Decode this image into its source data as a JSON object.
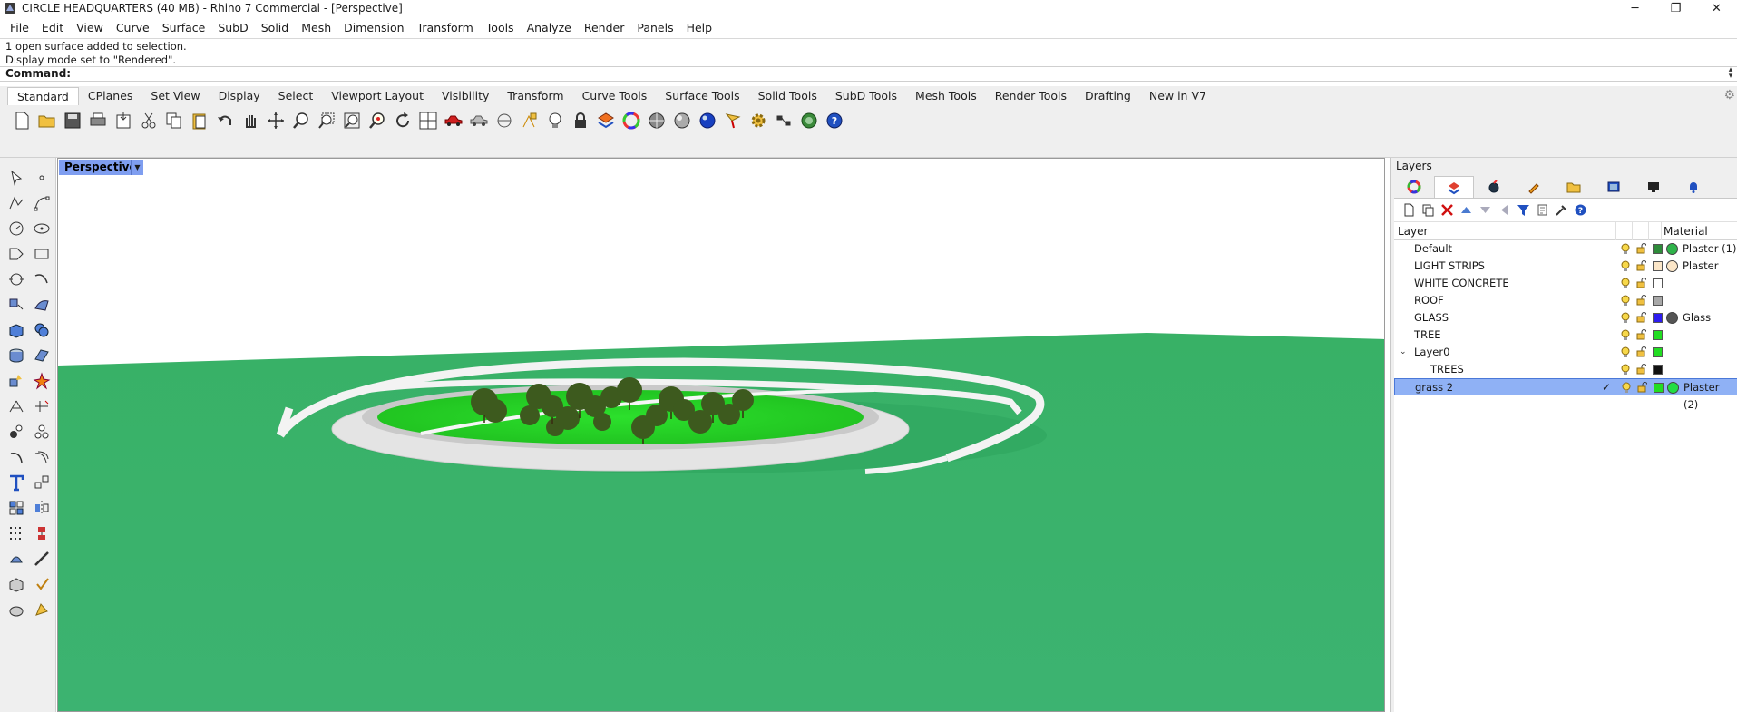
{
  "window": {
    "title": "CIRCLE HEADQUARTERS (40 MB) - Rhino 7 Commercial - [Perspective]",
    "controls": {
      "minimize": "─",
      "maximize": "❐",
      "close": "✕"
    }
  },
  "menu": [
    "File",
    "Edit",
    "View",
    "Curve",
    "Surface",
    "SubD",
    "Solid",
    "Mesh",
    "Dimension",
    "Transform",
    "Tools",
    "Analyze",
    "Render",
    "Panels",
    "Help"
  ],
  "command": {
    "history": [
      "1 open surface added to selection.",
      "Display mode set to \"Rendered\"."
    ],
    "prompt": "Command:"
  },
  "toolbar_tabs": {
    "active": "Standard",
    "items": [
      "Standard",
      "CPlanes",
      "Set View",
      "Display",
      "Select",
      "Viewport Layout",
      "Visibility",
      "Transform",
      "Curve Tools",
      "Surface Tools",
      "Solid Tools",
      "SubD Tools",
      "Mesh Tools",
      "Render Tools",
      "Drafting",
      "New in V7"
    ]
  },
  "toolbar_icons": [
    "new-file-icon",
    "open-icon",
    "save-icon",
    "print-icon",
    "import-icon",
    "cut-icon",
    "copy-icon",
    "paste-icon",
    "undo-icon",
    "pan-hand-icon",
    "rotate-view-icon",
    "zoom-icon",
    "zoom-window-icon",
    "zoom-extents-icon",
    "zoom-selected-icon",
    "rotate-icon",
    "four-viewports-icon",
    "car-icon",
    "named-view-icon",
    "cplane-icon",
    "snap-icon",
    "light-bulb-icon",
    "lock-icon",
    "layer-icon",
    "color-wheel-icon",
    "shaded-sphere-icon",
    "rendered-sphere-icon",
    "render-sphere-icon",
    "highlight-icon",
    "settings-gear-icon",
    "grasshopper-icon",
    "globe-icon",
    "help-icon"
  ],
  "left_tools": [
    "select-arrow-icon",
    "point-icon",
    "polyline-icon",
    "curve-point-icon",
    "circle-icon",
    "ellipse-icon",
    "polygon-icon",
    "rectangle-icon",
    "arc-icon",
    "arc-curve-icon",
    "transform-icon",
    "surface-icon",
    "box-icon",
    "boolean-icon",
    "cylinder-icon",
    "plane-icon",
    "explode-icon",
    "rebuild-icon",
    "split-icon",
    "trim-icon",
    "group-icon",
    "analyze-icon",
    "rotate-curve-icon",
    "offset-icon",
    "text-icon",
    "dimension-icon",
    "array-icon",
    "mirror-icon",
    "block-icon",
    "align-icon",
    "grid-icon",
    "gumball-icon",
    "material-icon",
    "check-icon",
    "shapes-icon",
    "paint-icon"
  ],
  "viewport": {
    "label": "Perspective",
    "arrow": "▼",
    "colors": {
      "ground": "#3cb371",
      "ring": "#f2f2f2",
      "grass": "#22d222",
      "trees": "#3d5a1e"
    }
  },
  "layers_panel": {
    "title": "Layers",
    "tab_icons": [
      "color-icon",
      "layers-icon",
      "render-icon",
      "brush-icon",
      "folder-icon",
      "display-icon",
      "monitor-icon",
      "bell-icon"
    ],
    "tool_icons": [
      "new-layer-icon",
      "new-sublayer-icon",
      "delete-icon",
      "move-up-icon",
      "move-down-icon",
      "move-left-icon",
      "filter-icon",
      "copy-layer-icon",
      "tools-icon",
      "help-icon"
    ],
    "header": {
      "layer": "Layer",
      "material": "Material"
    },
    "rows": [
      {
        "name": "Default",
        "color": "#2e8b3a",
        "material": "Plaster (1)",
        "mat_color": "#2fb34a",
        "child": false,
        "expand": "",
        "current": ""
      },
      {
        "name": "LIGHT STRIPS",
        "color": "#fbe6c8",
        "material": "Plaster",
        "mat_color": "#fbe6c8",
        "child": false,
        "expand": "",
        "current": ""
      },
      {
        "name": "WHITE CONCRETE",
        "color": "#ffffff",
        "material": "",
        "mat_color": "",
        "child": false,
        "expand": "",
        "current": ""
      },
      {
        "name": "ROOF",
        "color": "#a8a8a8",
        "material": "",
        "mat_color": "",
        "child": false,
        "expand": "",
        "current": ""
      },
      {
        "name": "GLASS",
        "color": "#2d1cf0",
        "material": "Glass",
        "mat_color": "#555555",
        "child": false,
        "expand": "",
        "current": ""
      },
      {
        "name": "TREE",
        "color": "#22dd22",
        "material": "",
        "mat_color": "",
        "child": false,
        "expand": "",
        "current": ""
      },
      {
        "name": "Layer0",
        "color": "#22dd22",
        "material": "",
        "mat_color": "",
        "child": false,
        "expand": "⌄",
        "current": ""
      },
      {
        "name": "TREES",
        "color": "#111111",
        "material": "",
        "mat_color": "",
        "child": true,
        "expand": "",
        "current": ""
      },
      {
        "name": "grass 2",
        "color": "#22dd22",
        "material": "Plaster (2)",
        "mat_color": "#22dd44",
        "child": false,
        "expand": "",
        "current": "✓",
        "selected": true
      }
    ]
  }
}
